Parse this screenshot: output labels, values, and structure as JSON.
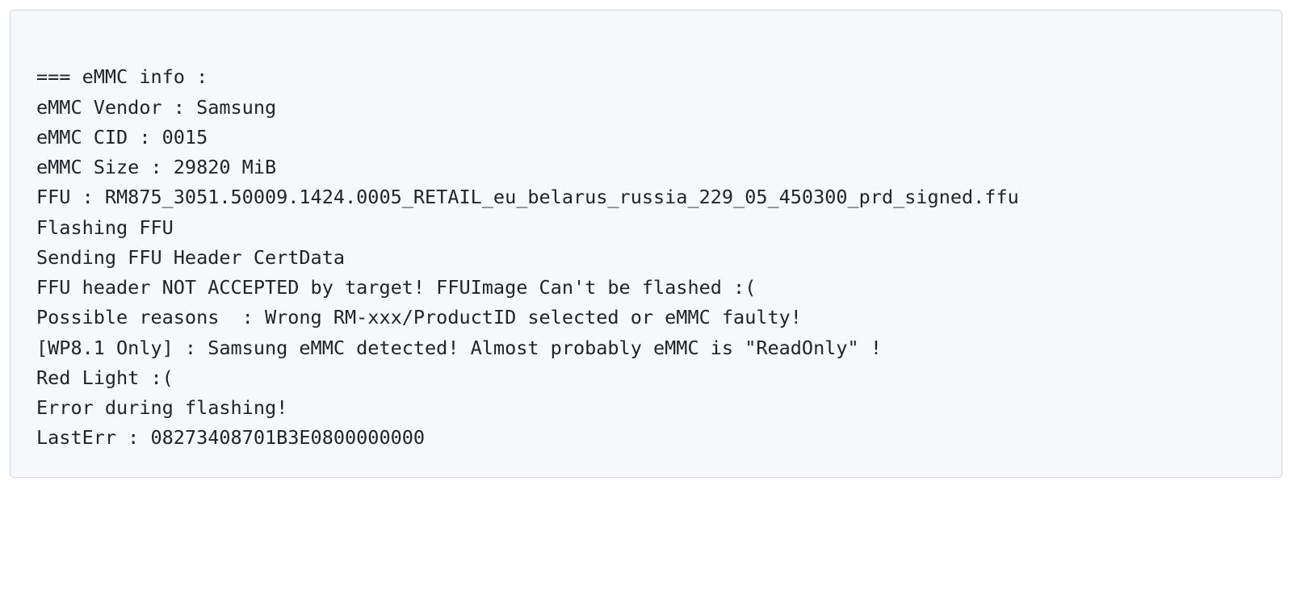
{
  "code": {
    "lines": [
      "",
      "=== eMMC info :",
      "eMMC Vendor : Samsung",
      "eMMC CID : 0015",
      "eMMC Size : 29820 MiB",
      "FFU : RM875_3051.50009.1424.0005_RETAIL_eu_belarus_russia_229_05_450300_prd_signed.ffu",
      "Flashing FFU",
      "Sending FFU Header CertData",
      "FFU header NOT ACCEPTED by target! FFUImage Can't be flashed :(",
      "Possible reasons  : Wrong RM-xxx/ProductID selected or eMMC faulty!",
      "[WP8.1 Only] : Samsung eMMC detected! Almost probably eMMC is \"ReadOnly\" !",
      "Red Light :(",
      "Error during flashing!",
      "LastErr : 08273408701B3E0800000000"
    ]
  }
}
